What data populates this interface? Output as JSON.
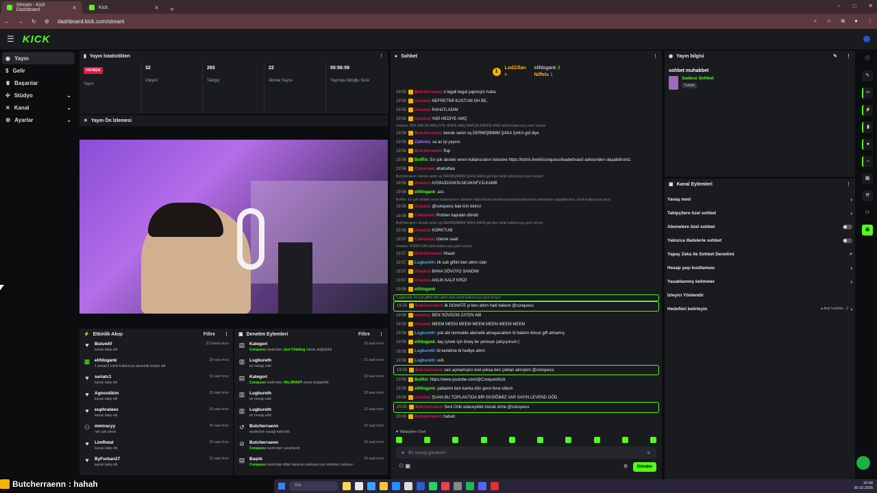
{
  "browser": {
    "tabs": [
      {
        "label": "Stream - Kick Dashboard",
        "active": true
      },
      {
        "label": "Kick",
        "active": false
      }
    ],
    "url": "dashboard.kick.com/stream"
  },
  "app": {
    "logo": "KICK"
  },
  "nav": [
    {
      "label": "Yayın",
      "icon": "broadcast-icon",
      "active": true
    },
    {
      "label": "Gelir",
      "icon": "dollar-icon"
    },
    {
      "label": "Başarılar",
      "icon": "trophy-icon"
    },
    {
      "label": "Stüdyo",
      "icon": "studio-icon",
      "expand": true
    },
    {
      "label": "Kanal",
      "icon": "channel-icon",
      "expand": true
    },
    {
      "label": "Ayarlar",
      "icon": "gear-icon",
      "expand": true
    }
  ],
  "stats": {
    "title": "Yayın İstatistikleri",
    "live_badge": "YAYINDA",
    "items": [
      {
        "label": "Yayın",
        "value": ""
      },
      {
        "label": "İzleyici",
        "value": "32"
      },
      {
        "label": "Takipçi",
        "value": "293"
      },
      {
        "label": "Abone Sayısı",
        "value": "22"
      },
      {
        "label": "Yayında Olduğu Süre",
        "value": "00:56:59"
      }
    ]
  },
  "preview": {
    "title": "Yayın Ön İzlemesi"
  },
  "feed": {
    "title": "Etkinlik Akışı",
    "filter": "Filtre",
    "items": [
      {
        "name": "Buluwlif",
        "desc": "kanalı takip etti",
        "time": "32 dakika önce",
        "icon": "heart"
      },
      {
        "name": "elifdogank",
        "desc": "1 seriatc1 isimli kullanıcıya abonelik hediye etti.",
        "time": "18 saat önce",
        "icon": "gift"
      },
      {
        "name": "seriatc1",
        "desc": "kanalı takip etti",
        "time": "18 saat önce",
        "icon": "heart"
      },
      {
        "name": "Agnostikim",
        "desc": "kanalı takip etti",
        "time": "20 saat önce",
        "icon": "heart"
      },
      {
        "name": "euphratees",
        "desc": "kanalı takip etti",
        "time": "20 saat önce",
        "icon": "heart"
      },
      {
        "name": "mmiracyy",
        "desc": "nah çek alındı",
        "time": "20 saat önce",
        "icon": "raid"
      },
      {
        "name": "LimRetat",
        "desc": "kanalı takip etti",
        "time": "22 saat önce",
        "icon": "heart"
      },
      {
        "name": "ByFurkan27",
        "desc": "kanalı takip etti",
        "time": "22 saat önce",
        "icon": "heart"
      }
    ]
  },
  "mod": {
    "title": "Denetim Eylemleri",
    "filter": "Filtre",
    "items": [
      {
        "name": "Kategori",
        "desc_pre": "Conquess",
        "desc": " tarafından ",
        "desc_hl": "Just Chatting",
        "desc_post": " olarak değiştirildi",
        "time": "20 saat önce",
        "icon": "category"
      },
      {
        "name": "Lugbureth",
        "desc": "bir mesajı sildi",
        "time": "21 saat önce",
        "icon": "trash"
      },
      {
        "name": "Kategori",
        "desc_pre": "Conquess",
        "desc": " tarafından ",
        "desc_hl": "VALORANT",
        "desc_post": " olarak değiştirildi",
        "time": "22 saat önce",
        "icon": "category"
      },
      {
        "name": "Lugbureth",
        "desc": "bir mesajı sildi",
        "time": "22 saat önce",
        "icon": "trash"
      },
      {
        "name": "Lugbureth",
        "desc": "bir mesajı sildi",
        "time": "22 saat önce",
        "icon": "trash"
      },
      {
        "name": "Butcherraenn",
        "desc": "tarafından yasağı kaldırıldı",
        "time": "22 saat önce",
        "icon": "unban"
      },
      {
        "name": "Butcherraenn",
        "desc_pre": "Conquess",
        "desc": " tarafından yasaklandı",
        "time": "22 saat önce",
        "icon": "ban"
      },
      {
        "name": "Başlık",
        "desc_pre": "Conquess",
        "desc": " tarafından Allah karamel makiyato içen erkekten saklasın",
        "time": "23 saat önce",
        "icon": "title"
      }
    ]
  },
  "chat": {
    "title": "Sohbet",
    "top": {
      "leader": "LodZillan",
      "leader_count": "6",
      "u2": "elifdogank",
      "u2_count": "3",
      "u3": "Niffels",
      "u3_count": "1",
      "coin": "1"
    },
    "messages": [
      {
        "t": "19:55",
        "u": "Butcherraenn",
        "c": "#e3184c",
        "m": ": o legali ilegal yapmıştır haha"
      },
      {
        "t": "19:55",
        "u": "Urasius",
        "c": "#e3184c",
        "m": ": NEFRETİMİ KUSTUM OH BE,"
      },
      {
        "t": "19:55",
        "u": "Urasius",
        "c": "#e3184c",
        "m": ": RAHATLADIM"
      },
      {
        "t": "19:56",
        "u": "Urasius",
        "c": "#e3184c",
        "m": ": %50 HEDİYE AMQ"
      },
      {
        "rep": "Urasius: PKK MIN DA AMQ RTE HİNDE AMQ BAHÇELİNİNDE AMQ isimli kullanıcıya yanıt veriyor"
      },
      {
        "t": "19:56",
        "u": "Butcherraenn",
        "c": "#e3184c",
        "m": ": bende senin sq DERMİŞİMMM ŞAKA ŞAKA gül diye"
      },
      {
        "t": "19:56",
        "u": "Zatkniia",
        "c": "#b06cff",
        "m": ": sa as iyi yayıns"
      },
      {
        "t": "19:56",
        "u": "Butcherraenn",
        "c": "#e3184c",
        "m": ": ftop"
      },
      {
        "t": "19:56",
        "u": "BotRix",
        "c": "#53fc18",
        "m": ": En çok destek veren kullanıcıların listesine https://botrix.live/k/conquess/leaderboard adresinden ulaşabilirsiniz."
      },
      {
        "t": "19:56",
        "u": "Cutesinee",
        "c": "#e3184c",
        "m": ": ahahahaa"
      },
      {
        "rep": "Butcherraenn: bende senin sq DERMİŞİMMM ŞAKA ŞAKA gül diye isimli kullanıcıya yanıt veriyor"
      },
      {
        "t": "19:56",
        "u": "Urasius",
        "c": "#e3184c",
        "m": ": ASSMJDXAKSLNCAKNFVJLKAMB"
      },
      {
        "t": "19:56",
        "u": "elifdogank",
        "c": "#53fc18",
        "m": ": ass"
      },
      {
        "rep": "BotRix: En çok destek veren kullanıcıların listesine https://botrix.live/k/conquess/leaderboard adresinden ulaşabilirsiniz. isimli kullanıcıya yanıt"
      },
      {
        "t": "19:56",
        "u": "Urasius",
        "c": "#e3184c",
        "m": ": @conquess bak kim birinci"
      },
      {
        "t": "19:56",
        "u": "Cutesinee",
        "c": "#e3184c",
        "m": ": Polisler kapıdan döndü"
      },
      {
        "rep": "Butcherraenn: bende senin sq DERMİŞİMMM ŞAKA ŞAKA gül diye isimli kullanıcıya yanıt veriyor"
      },
      {
        "t": "19:56",
        "u": "Urasius",
        "c": "#e3184c",
        "m": ": KORKTUM"
      },
      {
        "t": "19:57",
        "u": "Cutesinee",
        "c": "#e3184c",
        "m": ": izleme saati"
      },
      {
        "rep": "Urasius: KORKTUM isimli kullanıcıya yanıt veriyor"
      },
      {
        "t": "19:57",
        "u": "Butcherraenn",
        "c": "#e3184c",
        "m": ": hhaah"
      },
      {
        "t": "19:57",
        "u": "Lugbureth",
        "c": "#4aa8ff",
        "m": ": ilk sub giftini ben attım ulan"
      },
      {
        "t": "19:57",
        "u": "Urasius",
        "c": "#e3184c",
        "m": ": BANA SÖVÜYO SANDIM"
      },
      {
        "t": "19:57",
        "u": "Urasius",
        "c": "#e3184c",
        "m": ": ANLIK KALP KRİZİ"
      },
      {
        "t": "19:58",
        "u": "elifdogank",
        "c": "#53fc18",
        "m": ":"
      },
      {
        "rep": "Lugbureth: ilk sub giftini ben attım ulan isimli kullanıcıya yanıt veriyor",
        "hl": true
      },
      {
        "t": "19:58",
        "u": "Butcherraenn",
        "c": "#e3184c",
        "m": ": ilk DONATE yi ben attım hadi bakem @conquess",
        "hl": true
      },
      {
        "t": "19:58",
        "u": "Urasius",
        "c": "#e3184c",
        "m": ": BEN SÖVDÜM ZATEN ABİ"
      },
      {
        "t": "19:58",
        "u": "Urasius",
        "c": "#e3184c",
        "m": ": MEEM MEEM MEEM MEEM MEEM MEEM MEEM"
      },
      {
        "t": "19:58",
        "u": "Lugbureth",
        "c": "#4aa8ff",
        "m": ": yok abi normalde abonelik almayacaktım bi baktım kimse gift atmamış"
      },
      {
        "t": "19:58",
        "u": "elifdogank",
        "c": "#53fc18",
        "m": ": ilaç içmek için bisey ler yemeye çalışıyorum:("
      },
      {
        "t": "19:58",
        "u": "Lugbureth",
        "c": "#4aa8ff",
        "m": ": bi kendime bi hediye attım"
      },
      {
        "t": "19:58",
        "u": "Lugbureth",
        "c": "#4aa8ff",
        "m": ": sub"
      },
      {
        "t": "19:59",
        "u": "Butcherraenn",
        "c": "#e3184c",
        "m": ": sen açmamıştın kral yoksa ben çoktan atmıştım @conquess",
        "hl": true
      },
      {
        "t": "19:59",
        "u": "BotRix",
        "c": "#53fc18",
        "m": ": https://www.youtube.com/@ConquesKick"
      },
      {
        "t": "19:59",
        "u": "elifdogank",
        "c": "#53fc18",
        "m": ": patladım ben kanka dün gece fena oldum"
      },
      {
        "t": "19:59",
        "u": "Urasius",
        "c": "#e3184c",
        "m": ": ŞUAN BU TOPLANTIDA BİR EKSİĞİMİZ VAR SAYIN LEVEND GÖD"
      },
      {
        "t": "20:00",
        "u": "Butcherraenn",
        "c": "#e3184c",
        "m": ": Seni Ünlü edeceyikkk merak etme @conquess",
        "hl": true
      },
      {
        "t": "20:00",
        "u": "Butcherraenn",
        "c": "#e3184c",
        "m": ": hahah"
      }
    ],
    "sub_only": "Takipçilere Özel",
    "input_placeholder": "Bir mesaj gönderin",
    "send": "Gönder"
  },
  "info": {
    "title": "Yayın bilgisi",
    "stream_title": "sohbet muhabbet",
    "category": "Sadece Sohbet",
    "tag": "Turkish"
  },
  "actions": {
    "title": "Kanal Eylemleri",
    "items": [
      {
        "label": "Yavaş mod",
        "kind": "arrow"
      },
      {
        "label": "Takipçilere özel sohbet",
        "kind": "arrow"
      },
      {
        "label": "Abonelere özel sohbet",
        "kind": "toggle"
      },
      {
        "label": "Yalnızca ifadelerle sohbet",
        "kind": "toggle"
      },
      {
        "label": "Yapay Zeka ile Sohbet Denetimi",
        "kind": "ext"
      },
      {
        "label": "Hesap yaşı kısıtlaması",
        "kind": "arrow"
      },
      {
        "label": "Yasaklanmış kelimeler",
        "kind": "arrow"
      },
      {
        "label": "İzleyici Yönlendir",
        "kind": "none"
      },
      {
        "label": "Hedefleri belirleyin",
        "kind": "goals",
        "side": "Aktif hedefler - 2"
      }
    ]
  },
  "caption": {
    "user": "Butcherraenn",
    "text": ": hahah"
  },
  "taskbar": {
    "search": "Ara",
    "time": "20:00",
    "date": "30.10.2025"
  },
  "colors": {
    "accent": "#53fc18",
    "live": "#e3184c",
    "panel": "#191b1f",
    "bg": "#0b0d0f"
  }
}
